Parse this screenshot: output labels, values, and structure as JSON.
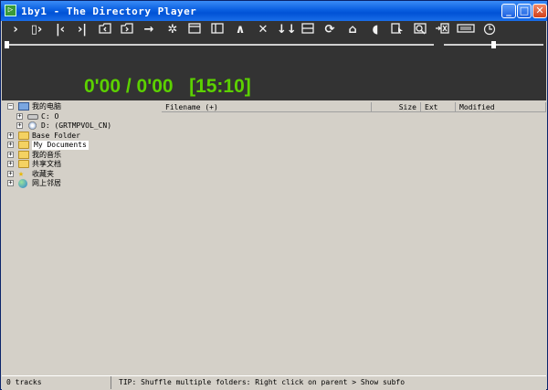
{
  "window": {
    "title": "1by1 - The Directory Player"
  },
  "toolbar": {
    "icons": [
      "play-icon",
      "play-pause-icon",
      "previous-icon",
      "next-icon",
      "folder-up-icon",
      "folder-next-icon",
      "arrow-right-icon",
      "settings-icon",
      "window-icon",
      "sidebar-icon",
      "chevron-up-icon",
      "close-x-icon",
      "sort-icon",
      "panel-icon",
      "repeat-icon",
      "home-icon",
      "speaker-icon",
      "document-cursor-icon",
      "search-icon",
      "exit-icon",
      "keyboard-icon",
      "clock-icon"
    ]
  },
  "player": {
    "time": "0'00 / 0'00   [15:10]",
    "seek_fraction": 0,
    "volume_fraction": 0.5
  },
  "tree": {
    "items": [
      {
        "label": "我的电脑",
        "icon": "computer-icon"
      },
      {
        "label": "C:  O",
        "icon": "drive-icon"
      },
      {
        "label": "D:  (GRTMPVOL_CN)",
        "icon": "cd-drive-icon"
      },
      {
        "label": "Base Folder",
        "icon": "folder-icon"
      },
      {
        "label": "My Documents",
        "icon": "folder-icon"
      },
      {
        "label": "我的音乐",
        "icon": "music-folder-icon"
      },
      {
        "label": "共享文档",
        "icon": "folder-icon"
      },
      {
        "label": "收藏夹",
        "icon": "favorites-star-icon"
      },
      {
        "label": "网上邻居",
        "icon": "network-globe-icon"
      }
    ]
  },
  "list": {
    "columns": [
      "Filename (+)",
      "Size",
      "Ext",
      "Modified"
    ]
  },
  "status": {
    "tracks": "0 tracks",
    "tip": "TIP: Shuffle multiple folders: Right click on parent > Show subfo"
  },
  "colors": {
    "title_bar": "#0a5fe0",
    "player_bg": "#333333",
    "time_text": "#5cd100"
  }
}
